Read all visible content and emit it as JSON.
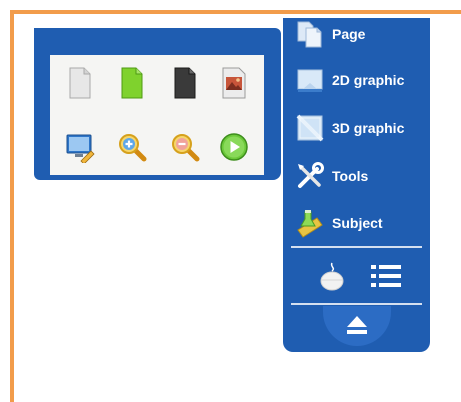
{
  "side_panel": {
    "items": [
      {
        "label": "Page",
        "icon": "page-icon"
      },
      {
        "label": "2D graphic",
        "icon": "2d-graphic-icon"
      },
      {
        "label": "3D graphic",
        "icon": "3d-graphic-icon"
      },
      {
        "label": "Tools",
        "icon": "tools-icon"
      },
      {
        "label": "Subject",
        "icon": "subject-icon"
      }
    ],
    "extra_icons": [
      "mouse-icon",
      "list-icon"
    ],
    "collapse_icon": "eject-icon"
  },
  "toolbox": {
    "row1": [
      "blank-page-icon",
      "green-page-icon",
      "black-page-icon",
      "image-page-icon"
    ],
    "row2": [
      "edit-screen-icon",
      "zoom-in-icon",
      "zoom-out-icon",
      "play-icon"
    ]
  },
  "colors": {
    "panel_blue": "#1F5DB1",
    "frame_orange": "#F29C4B",
    "green_page": "#7FD22D",
    "play_green": "#6CC93A"
  }
}
